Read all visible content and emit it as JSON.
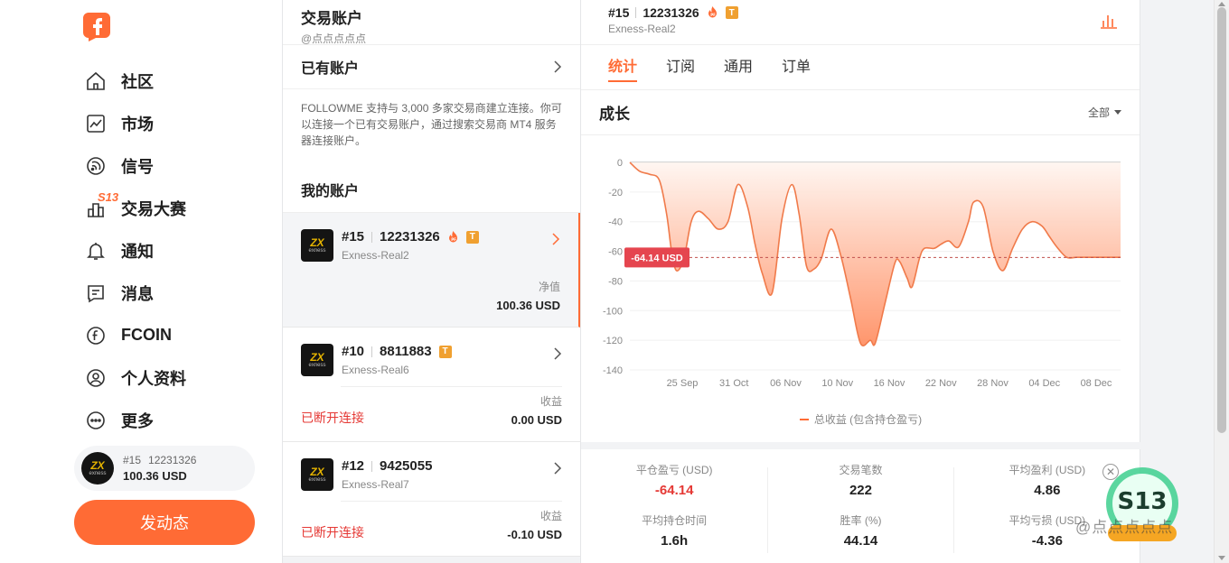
{
  "sidebar": {
    "nav": [
      {
        "label": "社区",
        "icon": "home-icon"
      },
      {
        "label": "市场",
        "icon": "market-chart-icon"
      },
      {
        "label": "信号",
        "icon": "signal-icon"
      },
      {
        "label": "交易大赛",
        "icon": "contest-icon",
        "badge": "S13"
      },
      {
        "label": "通知",
        "icon": "bell-icon"
      },
      {
        "label": "消息",
        "icon": "message-icon"
      },
      {
        "label": "FCOIN",
        "icon": "fcoin-icon"
      },
      {
        "label": "个人资料",
        "icon": "profile-icon"
      },
      {
        "label": "更多",
        "icon": "more-icon"
      }
    ],
    "account_card": {
      "id": "#15",
      "number": "12231326",
      "balance": "100.36 USD"
    },
    "post_button": "发动态"
  },
  "middle": {
    "title": "交易账户",
    "subtitle": "@点点点点点",
    "have_account": {
      "label": "已有账户",
      "desc": "FOLLOWME 支持与 3,000 多家交易商建立连接。你可以连接一个已有交易账户，通过搜索交易商 MT4 服务器连接账户。"
    },
    "my_accounts_label": "我的账户",
    "accounts": [
      {
        "id": "#15",
        "number": "12231326",
        "server": "Exness-Real2",
        "value_label": "净值",
        "value": "100.36 USD",
        "status": "",
        "active": true,
        "fire": true
      },
      {
        "id": "#10",
        "number": "8811883",
        "server": "Exness-Real6",
        "value_label": "收益",
        "value": "0.00 USD",
        "status": "已断开连接",
        "active": false,
        "fire": false
      },
      {
        "id": "#12",
        "number": "9425055",
        "server": "Exness-Real7",
        "value_label": "收益",
        "value": "-0.10 USD",
        "status": "已断开连接",
        "active": false,
        "fire": false
      }
    ],
    "badge_t": "T"
  },
  "right": {
    "account_id": "#15",
    "account_number": "12231326",
    "server": "Exness-Real2",
    "tabs": [
      "统计",
      "订阅",
      "通用",
      "订单"
    ],
    "active_tab": 0,
    "growth_title": "成长",
    "range_label": "全部",
    "legend": "总收益 (包含持仓盈亏)",
    "stats": [
      {
        "label": "平仓盈亏 (USD)",
        "value": "-64.14",
        "negative": true
      },
      {
        "label": "交易笔数",
        "value": "222",
        "negative": false
      },
      {
        "label": "平均盈利 (USD)",
        "value": "4.86",
        "negative": false
      },
      {
        "label": "平均持仓时间",
        "value": "1.6h",
        "negative": false
      },
      {
        "label": "胜率 (%)",
        "value": "44.14",
        "negative": false
      },
      {
        "label": "平均亏损 (USD)",
        "value": "-4.36",
        "negative": false
      }
    ]
  },
  "watermark": "@点点点点点",
  "colors": {
    "accent": "#ff6b35",
    "negative": "#e53935",
    "ref_label_bg": "#e5454f"
  },
  "chart_data": {
    "type": "area",
    "xlabel": "",
    "ylabel": "",
    "ylim": [
      -140,
      0
    ],
    "yticks": [
      0,
      -20,
      -40,
      -60,
      -80,
      -100,
      -120,
      -140
    ],
    "xticks": [
      "25 Sep",
      "31 Oct",
      "06 Nov",
      "10 Nov",
      "16 Nov",
      "22 Nov",
      "28 Nov",
      "04 Dec",
      "08 Dec"
    ],
    "reference_line": {
      "value": -64.14,
      "label": "-64.14 USD"
    },
    "grid": true,
    "series": [
      {
        "name": "总收益 (包含持仓盈亏)",
        "x": [
          0,
          0.02,
          0.04,
          0.06,
          0.075,
          0.085,
          0.095,
          0.11,
          0.125,
          0.14,
          0.16,
          0.18,
          0.2,
          0.22,
          0.24,
          0.255,
          0.27,
          0.29,
          0.31,
          0.33,
          0.345,
          0.36,
          0.375,
          0.39,
          0.41,
          0.43,
          0.45,
          0.47,
          0.49,
          0.5,
          0.52,
          0.54,
          0.55,
          0.565,
          0.575,
          0.59,
          0.6,
          0.62,
          0.635,
          0.65,
          0.67,
          0.69,
          0.7,
          0.72,
          0.74,
          0.76,
          0.78,
          0.8,
          0.82,
          0.84,
          0.855,
          0.87,
          0.89,
          0.91,
          0.93,
          0.95,
          0.97,
          0.99,
          1.0
        ],
        "y": [
          0,
          -6,
          -8,
          -12,
          -35,
          -60,
          -73,
          -65,
          -40,
          -33,
          -38,
          -45,
          -40,
          -15,
          -30,
          -55,
          -75,
          -88,
          -38,
          -15,
          -35,
          -70,
          -72,
          -65,
          -45,
          -63,
          -92,
          -122,
          -120,
          -122,
          -95,
          -68,
          -67,
          -78,
          -84,
          -65,
          -58,
          -58,
          -55,
          -53,
          -57,
          -40,
          -27,
          -30,
          -60,
          -73,
          -58,
          -45,
          -40,
          -43,
          -50,
          -57,
          -64,
          -64,
          -64,
          -64,
          -64,
          -64,
          -64
        ]
      }
    ]
  }
}
